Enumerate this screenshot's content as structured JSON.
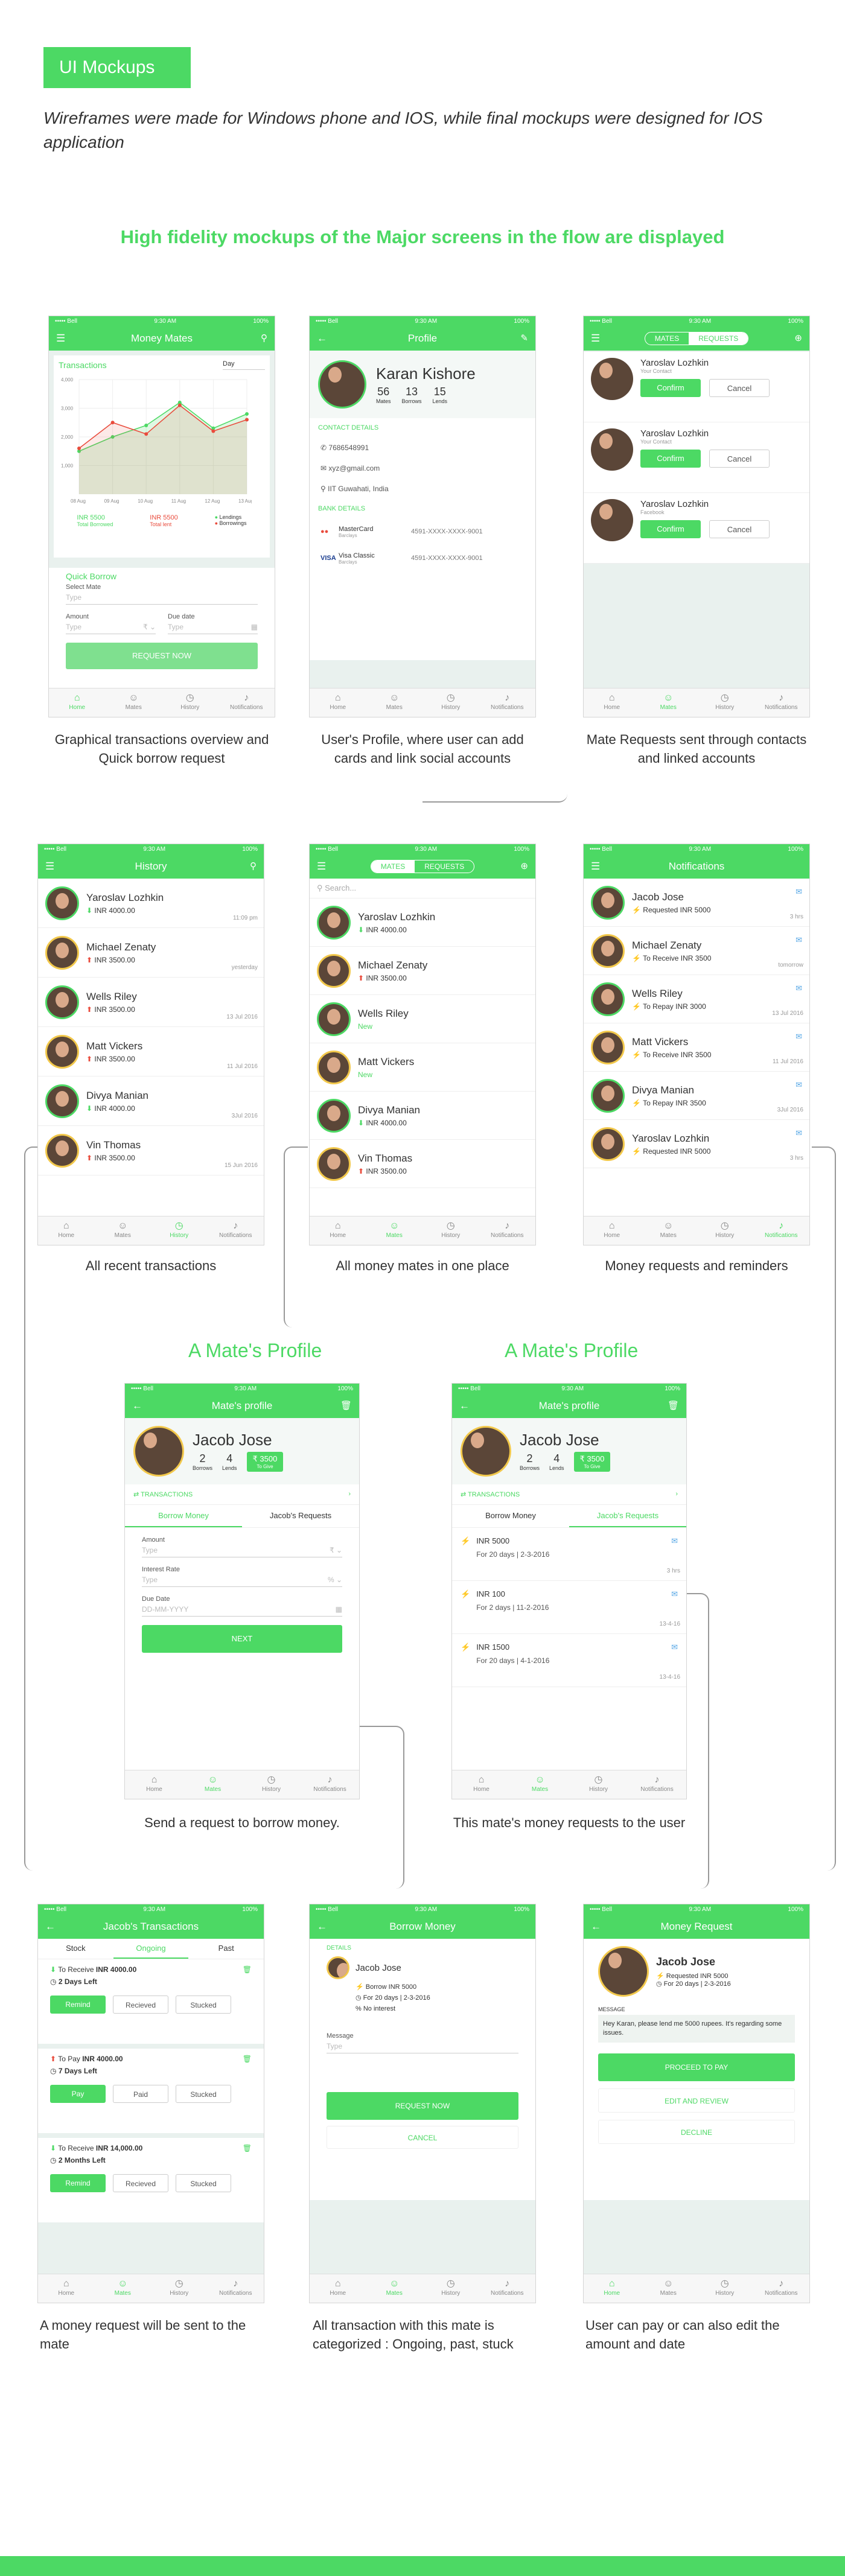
{
  "header": {
    "tag": "UI Mockups",
    "intro": "Wireframes were made for Windows phone and IOS, while final mockups were designed for IOS application",
    "subtitle": "High fidelity mockups of the Major screens in the flow are displayed"
  },
  "status": {
    "carrier": "••••• Bell",
    "time": "9:30 AM",
    "battery": "100%"
  },
  "tabs": {
    "home": "Home",
    "mates": "Mates",
    "history": "History",
    "notifications": "Notifications"
  },
  "s1": {
    "title": "Money Mates",
    "card_title": "Transactions",
    "period": "Day",
    "legend_lendings": "Lendings",
    "legend_borrowings": "Borrowings",
    "total_borrowed_val": "INR 5500",
    "total_borrowed": "Total Borrowed",
    "total_lent_val": "INR 5500",
    "total_lent": "Total lent",
    "y_ticks": [
      "4,000",
      "3,000",
      "2,000",
      "1,000"
    ],
    "x_ticks": [
      "08 Aug",
      "09 Aug",
      "10 Aug",
      "11 Aug",
      "12 Aug",
      "13 Aug"
    ],
    "quick": "Quick Borrow",
    "select_mate": "Select Mate",
    "type": "Type",
    "amount": "Amount",
    "due": "Due date",
    "button": "REQUEST NOW",
    "caption": "Graphical transactions overview and Quick borrow request"
  },
  "chart_data": {
    "type": "line",
    "categories": [
      "08 Aug",
      "09 Aug",
      "10 Aug",
      "11 Aug",
      "12 Aug",
      "13 Aug"
    ],
    "series": [
      {
        "name": "Lendings",
        "values": [
          1500,
          2000,
          2400,
          3200,
          2300,
          2800
        ]
      },
      {
        "name": "Borrowings",
        "values": [
          1600,
          2500,
          2100,
          3100,
          2200,
          2600
        ]
      }
    ],
    "ylim": [
      0,
      4000
    ]
  },
  "s2": {
    "title": "Profile",
    "name": "Karan Kishore",
    "mates": "56",
    "mates_l": "Mates",
    "borrows": "13",
    "borrows_l": "Borrows",
    "lends": "15",
    "lends_l": "Lends",
    "contact": "CONTACT DETAILS",
    "phone": "7686548991",
    "email": "xyz@gmail.com",
    "loc": "IIT Guwahati, India",
    "bank": "BANK DETAILS",
    "card1": "MasterCard",
    "card1s": "Barclays",
    "card1n": "4591-XXXX-XXXX-9001",
    "card2": "Visa Classic",
    "card2s": "Barclays",
    "card2n": "4591-XXXX-XXXX-9001",
    "caption": "User's Profile, where user can add cards and link social accounts"
  },
  "s3": {
    "seg_a": "MATES",
    "seg_b": "REQUESTS",
    "items": [
      {
        "name": "Yaroslav Lozhkin",
        "src": "Your Contact"
      },
      {
        "name": "Yaroslav Lozhkin",
        "src": "Your Contact"
      },
      {
        "name": "Yaroslav Lozhkin",
        "src": "Facebook"
      }
    ],
    "confirm": "Confirm",
    "cancel": "Cancel",
    "caption": "Mate Requests sent through contacts and linked accounts"
  },
  "s4": {
    "title": "History",
    "items": [
      {
        "name": "Yaroslav Lozhkin",
        "amt": "INR 4000.00",
        "dir": "up",
        "time": "11:09 pm"
      },
      {
        "name": "Michael Zenaty",
        "amt": "INR 3500.00",
        "dir": "dn",
        "time": "yesterday"
      },
      {
        "name": "Wells Riley",
        "amt": "INR 3500.00",
        "dir": "dn",
        "time": "13 Jul 2016"
      },
      {
        "name": "Matt Vickers",
        "amt": "INR 3500.00",
        "dir": "dn",
        "time": "11 Jul 2016"
      },
      {
        "name": "Divya Manian",
        "amt": "INR 4000.00",
        "dir": "up",
        "time": "3Jul 2016"
      },
      {
        "name": "Vin Thomas",
        "amt": "INR 3500.00",
        "dir": "dn",
        "time": "15 Jun 2016"
      }
    ],
    "caption": "All recent transactions"
  },
  "s5": {
    "seg_a": "MATES",
    "seg_b": "REQUESTS",
    "search": "Search...",
    "items": [
      {
        "name": "Yaroslav Lozhkin",
        "amt": "INR 4000.00",
        "dir": "up"
      },
      {
        "name": "Michael Zenaty",
        "amt": "INR 3500.00",
        "dir": "dn"
      },
      {
        "name": "Wells Riley",
        "amt": "New",
        "dir": "new"
      },
      {
        "name": "Matt Vickers",
        "amt": "New",
        "dir": "new"
      },
      {
        "name": "Divya Manian",
        "amt": "INR 4000.00",
        "dir": "up"
      },
      {
        "name": "Vin Thomas",
        "amt": "INR 3500.00",
        "dir": "dn"
      }
    ],
    "caption": "All money mates in one place"
  },
  "s6": {
    "title": "Notifications",
    "items": [
      {
        "name": "Jacob Jose",
        "text": "Requested INR 5000",
        "time": "3 hrs"
      },
      {
        "name": "Michael Zenaty",
        "text": "To Receive INR 3500",
        "time": "tomorrow"
      },
      {
        "name": "Wells Riley",
        "text": "To Repay INR 3000",
        "time": "13 Jul 2016"
      },
      {
        "name": "Matt Vickers",
        "text": "To Receive INR 3500",
        "time": "11 Jul 2016"
      },
      {
        "name": "Divya Manian",
        "text": "To Repay INR 3500",
        "time": "3Jul 2016"
      },
      {
        "name": "Yaroslav Lozhkin",
        "text": "Requested INR 5000",
        "time": "3 hrs"
      }
    ],
    "caption": "Money requests and reminders"
  },
  "mp": {
    "heading": "A Mate's Profile",
    "title": "Mate's profile",
    "name": "Jacob Jose",
    "borrows": "2",
    "borrows_l": "Borrows",
    "lends": "4",
    "lends_l": "Lends",
    "owe": "₹ 3500",
    "owe_l": "To Give",
    "trans": "TRANSACTIONS",
    "tab_a": "Borrow Money",
    "tab_b": "Jacob's Requests"
  },
  "s7": {
    "amount": "Amount",
    "type": "Type",
    "rate": "Interest Rate",
    "due": "Due Date",
    "date_ph": "DD-MM-YYYY",
    "next": "NEXT",
    "caption": "Send a request to borrow money."
  },
  "s8": {
    "items": [
      {
        "amt": "INR 5000",
        "text": "For 20 days | 2-3-2016",
        "time": "3 hrs"
      },
      {
        "amt": "INR 100",
        "text": "For 2 days | 11-2-2016",
        "time": "13-4-16"
      },
      {
        "amt": "INR 1500",
        "text": "For 20 days | 4-1-2016",
        "time": "13-4-16"
      }
    ],
    "caption": "This mate's money requests to the user"
  },
  "s9": {
    "title": "Jacob's Transactions",
    "t1": "Stock",
    "t2": "Ongoing",
    "t3": "Past",
    "items": [
      {
        "lbl": "To Receive",
        "amt": "INR 4000.00",
        "left": "2 Days Left",
        "b1": "Remind",
        "b2": "Recieved",
        "b3": "Stucked"
      },
      {
        "lbl": "To Pay",
        "amt": "INR 4000.00",
        "left": "7 Days Left",
        "b1": "Pay",
        "b2": "Paid",
        "b3": "Stucked"
      },
      {
        "lbl": "To Receive",
        "amt": "INR 14,000.00",
        "left": "2 Months Left",
        "b1": "Remind",
        "b2": "Recieved",
        "b3": "Stucked"
      }
    ],
    "caption": "A money request will be sent to the mate"
  },
  "s10": {
    "title": "Borrow Money",
    "details": "DETAILS",
    "name": "Jacob Jose",
    "l1": "Borrow INR 5000",
    "l2": "For 20 days | 2-3-2016",
    "l3": "No interest",
    "msg": "Message",
    "type": "Type",
    "btn": "REQUEST NOW",
    "cancel": "CANCEL",
    "caption": "All transaction with this mate is categorized : Ongoing, past, stuck"
  },
  "s11": {
    "title": "Money Request",
    "name": "Jacob Jose",
    "l1": "Requested INR 5000",
    "l2": "For 20 days | 2-3-2016",
    "msg_l": "MESSAGE",
    "msg": "Hey Karan, please lend me 5000 rupees. It's regarding some issues.",
    "pay": "PROCEED TO PAY",
    "edit": "EDIT AND REVIEW",
    "decline": "DECLINE",
    "caption": "User can pay or can also edit the amount and date"
  }
}
